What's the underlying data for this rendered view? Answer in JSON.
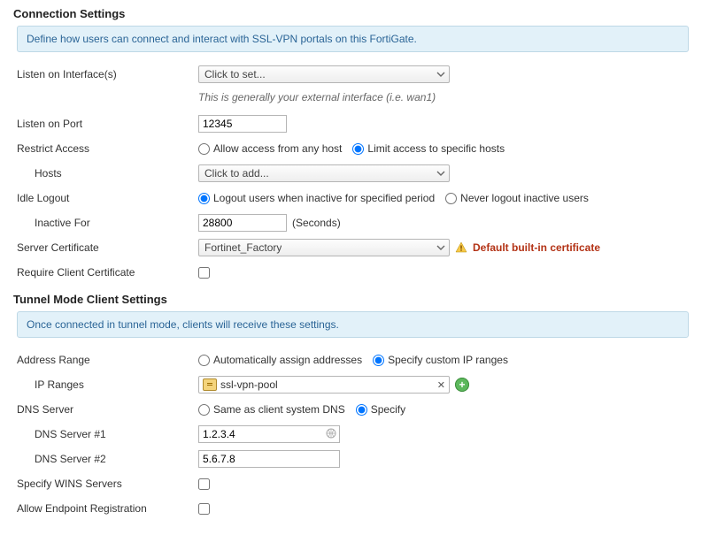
{
  "sections": {
    "connection": {
      "title": "Connection Settings",
      "info": "Define how users can connect and interact with SSL-VPN portals on this FortiGate.",
      "listen_interface": {
        "label": "Listen on Interface(s)",
        "value": "Click to set...",
        "hint": "This is generally your external interface (i.e. wan1)"
      },
      "listen_port": {
        "label": "Listen on Port",
        "value": "12345"
      },
      "restrict": {
        "label": "Restrict Access",
        "opts": [
          "Allow access from any host",
          "Limit access to specific hosts"
        ],
        "selected": 1
      },
      "hosts": {
        "label": "Hosts",
        "value": "Click to add..."
      },
      "idle": {
        "label": "Idle Logout",
        "opts": [
          "Logout users when inactive for specified period",
          "Never logout inactive users"
        ],
        "selected": 0
      },
      "inactive": {
        "label": "Inactive For",
        "value": "28800",
        "unit": "(Seconds)"
      },
      "cert": {
        "label": "Server Certificate",
        "value": "Fortinet_Factory",
        "warning": "Default built-in certificate"
      },
      "require_client": {
        "label": "Require Client Certificate",
        "checked": false
      }
    },
    "tunnel": {
      "title": "Tunnel Mode Client Settings",
      "info": "Once connected in tunnel mode, clients will receive these settings.",
      "addr_range": {
        "label": "Address Range",
        "opts": [
          "Automatically assign addresses",
          "Specify custom IP ranges"
        ],
        "selected": 1
      },
      "ip_ranges": {
        "label": "IP Ranges",
        "value": "ssl-vpn-pool"
      },
      "dns": {
        "label": "DNS Server",
        "opts": [
          "Same as client system DNS",
          "Specify"
        ],
        "selected": 1
      },
      "dns1": {
        "label": "DNS Server #1",
        "value": "1.2.3.4"
      },
      "dns2": {
        "label": "DNS Server #2",
        "value": "5.6.7.8"
      },
      "wins": {
        "label": "Specify WINS Servers",
        "checked": false
      },
      "endpoint": {
        "label": "Allow Endpoint Registration",
        "checked": false
      }
    }
  }
}
